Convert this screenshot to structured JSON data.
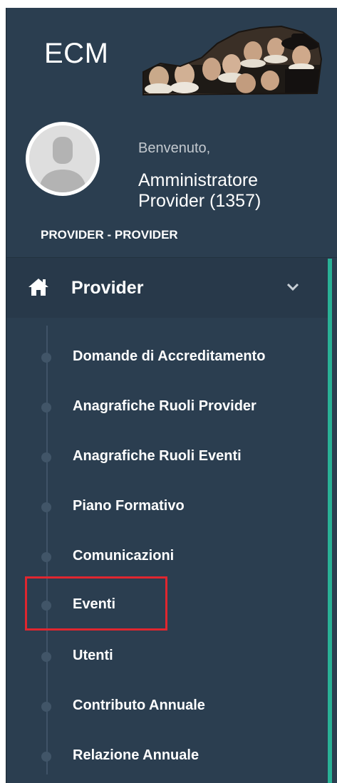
{
  "header": {
    "brand": "ECM",
    "welcome": "Benvenuto,",
    "user_name": "Amministratore Provider (1357)",
    "role": "PROVIDER - PROVIDER"
  },
  "menu": {
    "title": "Provider",
    "items": [
      {
        "label": "Domande di Accreditamento"
      },
      {
        "label": "Anagrafiche Ruoli Provider"
      },
      {
        "label": "Anagrafiche Ruoli Eventi"
      },
      {
        "label": "Piano Formativo"
      },
      {
        "label": "Comunicazioni"
      },
      {
        "label": "Eventi",
        "highlighted": true
      },
      {
        "label": "Utenti"
      },
      {
        "label": "Contributo Annuale"
      },
      {
        "label": "Relazione Annuale"
      }
    ]
  },
  "colors": {
    "sidebar_bg": "#2b3e50",
    "accent": "#29b196",
    "highlight": "#e0262f"
  },
  "icons": {
    "home": "home-icon",
    "chevron": "chevron-down-icon",
    "avatar": "user-avatar-icon",
    "logo": "portrait-painting-logo"
  }
}
